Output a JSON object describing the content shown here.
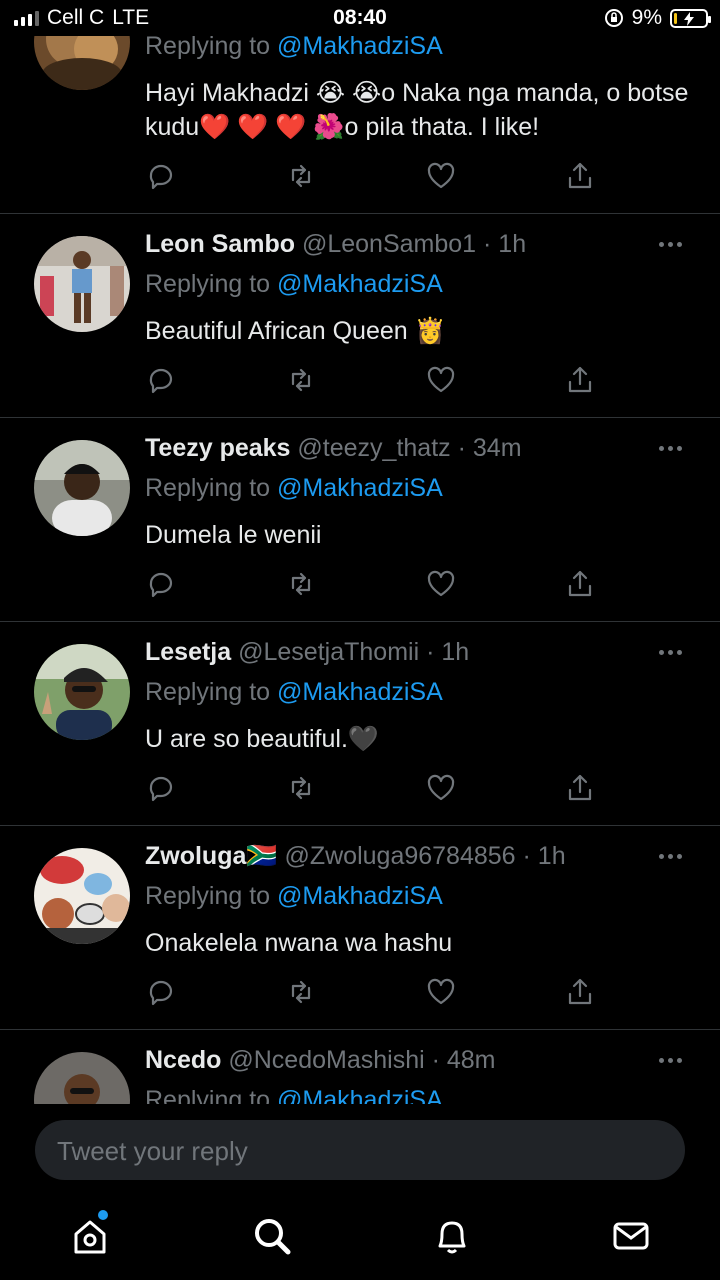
{
  "status_bar": {
    "carrier": "Cell C",
    "network": "LTE",
    "time": "08:40",
    "battery_percent": "9%",
    "battery_level": 0.09
  },
  "replying_prefix": "Replying to ",
  "replying_handle": "@MakhadziSA",
  "replies": [
    {
      "text": "Hayi Makhadzi 😭 😭o Naka nga manda, o botse kudu❤️ ❤️ ❤️ 🌺o pila thata. I like!"
    },
    {
      "name": "Leon Sambo",
      "handle": "@LeonSambo1",
      "time": "1h",
      "text": "Beautiful African Queen 👸"
    },
    {
      "name": "Teezy peaks",
      "handle": "@teezy_thatz",
      "time": "34m",
      "text": "Dumela le wenii"
    },
    {
      "name": "Lesetja",
      "handle": "@LesetjaThomii",
      "time": "1h",
      "text": "U are so beautiful.🖤"
    },
    {
      "name": "Zwoluga🇿🇦",
      "handle": "@Zwoluga96784856",
      "time": "1h",
      "text": "Onakelela nwana wa hashu"
    },
    {
      "name": "Ncedo",
      "handle": "@NcedoMashishi",
      "time": "48m"
    }
  ],
  "reply_input": {
    "placeholder": "Tweet your reply"
  },
  "tabs": [
    "home-icon",
    "search-icon",
    "notifications-icon",
    "messages-icon"
  ],
  "colors": {
    "accent": "#1d9bf0",
    "background": "#000000",
    "muted": "#71767b"
  }
}
